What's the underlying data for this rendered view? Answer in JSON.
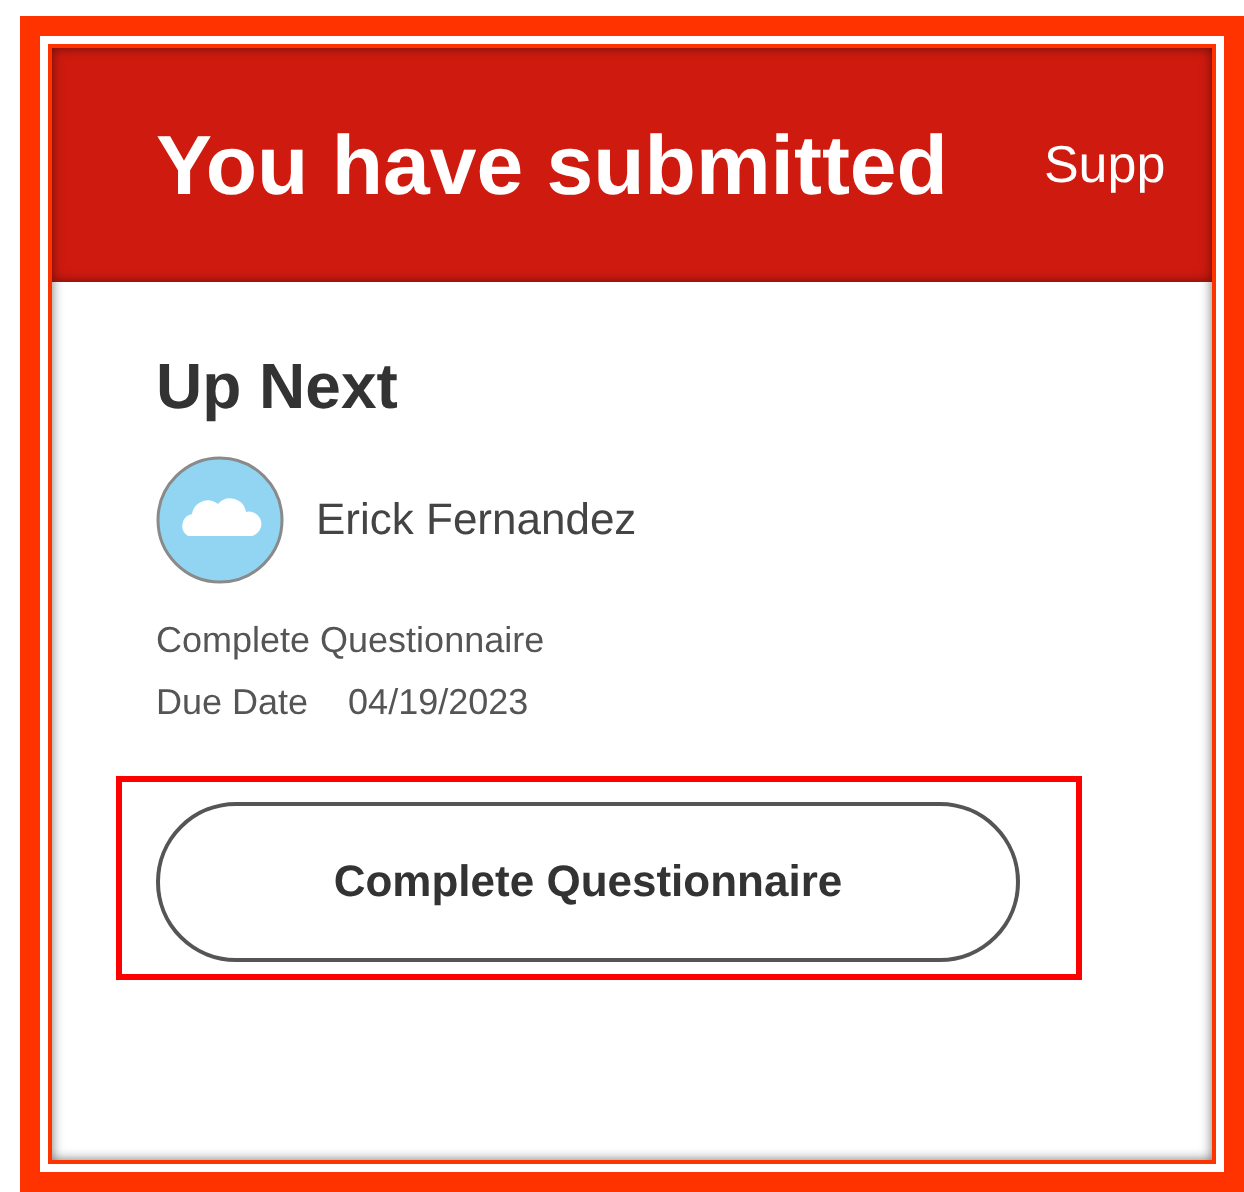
{
  "header": {
    "title": "You have submitted",
    "side_text": "Supp"
  },
  "up_next": {
    "title": "Up Next",
    "person": "Erick Fernandez",
    "task": "Complete Questionnaire",
    "due_label": "Due Date",
    "due_date": "04/19/2023",
    "button": "Complete Questionnaire"
  }
}
